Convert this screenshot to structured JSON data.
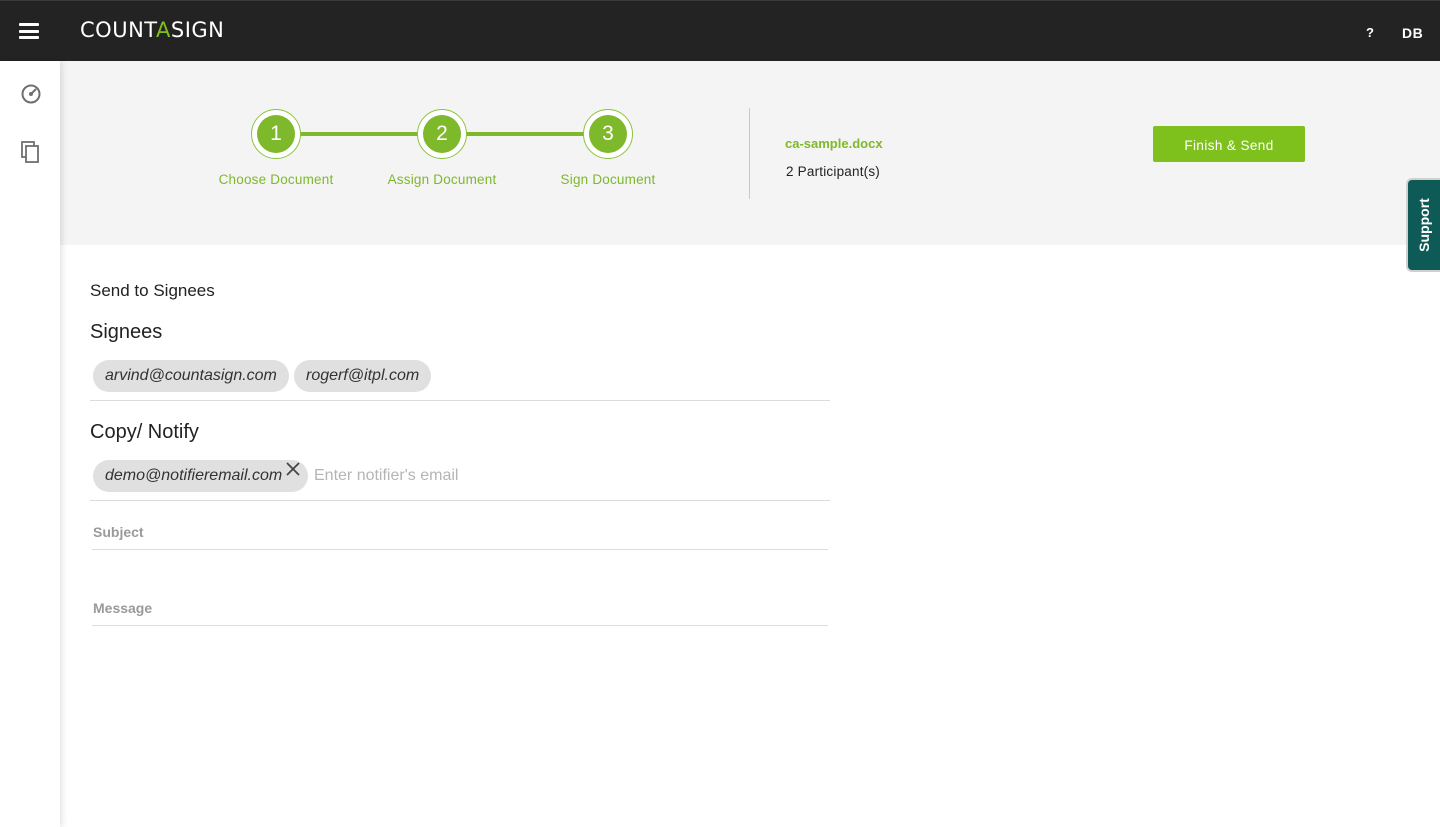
{
  "topbar": {
    "logo_prefix": "COUNT",
    "logo_accent": "A",
    "logo_suffix": "SIGN",
    "help_label": "?",
    "user_initials": "DB"
  },
  "sidebar": {
    "items": [
      {
        "icon": "dashboard-gauge-icon"
      },
      {
        "icon": "documents-copy-icon"
      }
    ]
  },
  "stepper": {
    "steps": [
      {
        "number": "1",
        "label": "Choose Document"
      },
      {
        "number": "2",
        "label": "Assign Document"
      },
      {
        "number": "3",
        "label": "Sign Document"
      }
    ]
  },
  "document": {
    "name": "ca-sample.docx",
    "participants": "2 Participant(s)"
  },
  "actions": {
    "finish_label": "Finish & Send",
    "support_label": "Support"
  },
  "form": {
    "section_title": "Send to Signees",
    "signees_label": "Signees",
    "signees": [
      "arvind@countasign.com",
      "rogerf@itpl.com"
    ],
    "notify_label": "Copy/ Notify",
    "notifiers": [
      "demo@notifieremail.com"
    ],
    "notify_placeholder": "Enter notifier's email",
    "subject_label": "Subject",
    "message_label": "Message"
  },
  "colors": {
    "accent_green": "#7ec11d",
    "step_green": "#7eb82b",
    "topbar": "#232323",
    "support_teal": "#0e5a57"
  }
}
